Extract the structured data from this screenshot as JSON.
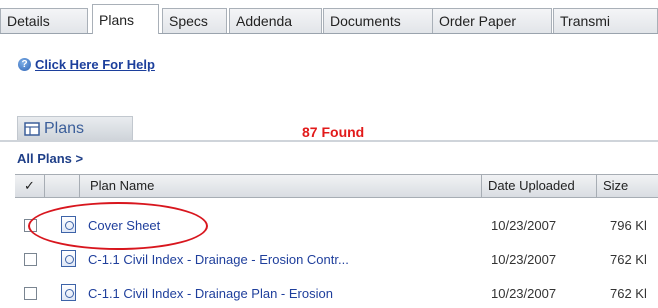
{
  "tabs": [
    {
      "label": "Details",
      "active": false
    },
    {
      "label": "Plans",
      "active": true
    },
    {
      "label": "Specs",
      "active": false
    },
    {
      "label": "Addenda",
      "active": false
    },
    {
      "label": "Documents",
      "active": false
    },
    {
      "label": "Order Paper",
      "active": false
    },
    {
      "label": "Transmi",
      "active": false
    }
  ],
  "help": {
    "label": "Click Here For Help"
  },
  "plans": {
    "label": "Plans",
    "found": "87 Found"
  },
  "breadcrumb": "All Plans >",
  "table": {
    "headers": {
      "check": "✓",
      "name": "Plan Name",
      "date": "Date Uploaded",
      "size": "Size"
    },
    "rows": [
      {
        "name": "Cover Sheet",
        "date": "10/23/2007",
        "size": "796 Kl"
      },
      {
        "name": "C-1.1 Civil Index - Drainage - Erosion Contr...",
        "date": "10/23/2007",
        "size": "762 Kl"
      },
      {
        "name": "C-1.1 Civil Index - Drainage Plan - Erosion",
        "date": "10/23/2007",
        "size": "762 Kl"
      }
    ]
  },
  "colors": {
    "found": "#e21a1a",
    "link": "#1c3f9c",
    "annotation": "#d8161e"
  }
}
